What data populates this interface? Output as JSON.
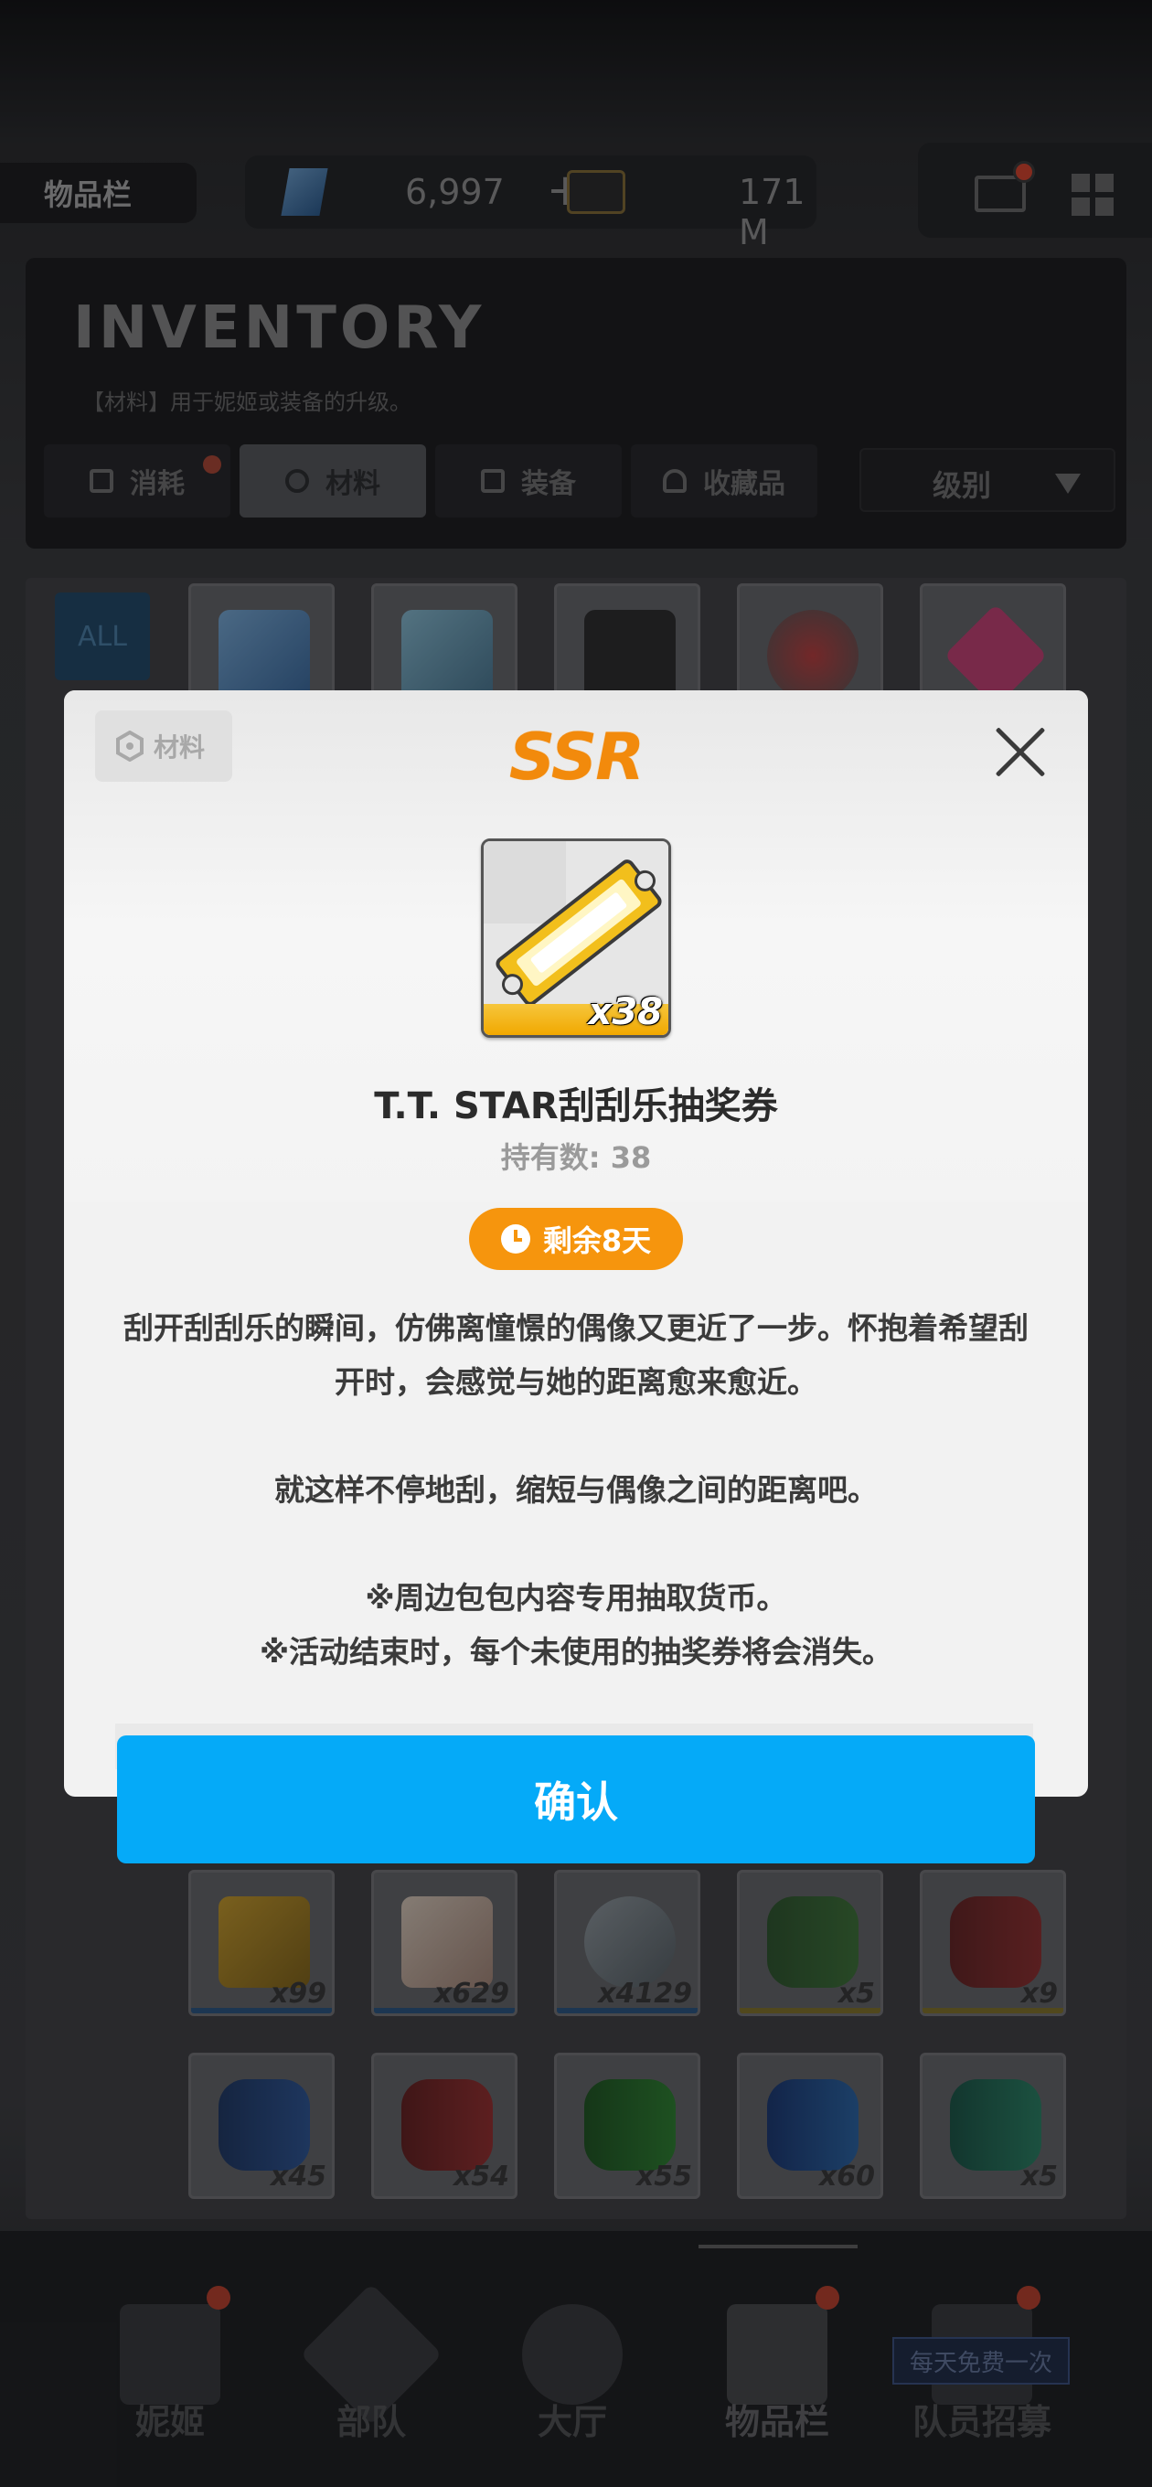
{
  "topbar": {
    "title": "物品栏",
    "gem_amount": "6,997",
    "plus": "+",
    "credit_amount": "171 M"
  },
  "inventory": {
    "title": "INVENTORY",
    "description": "【材料】用于妮姬或装备的升级。",
    "tabs": [
      {
        "label": "消耗",
        "active": false
      },
      {
        "label": "材料",
        "active": true
      },
      {
        "label": "装备",
        "active": false
      },
      {
        "label": "收藏品",
        "active": false
      }
    ],
    "sort_label": "级别",
    "filter_all": "ALL"
  },
  "grid_counts": {
    "row2": [
      "x99",
      "x629",
      "x4129",
      "x5",
      "x9"
    ],
    "row3": [
      "x45",
      "x54",
      "x55",
      "x60",
      "x5"
    ]
  },
  "nav": {
    "items": [
      "妮姬",
      "部队",
      "大厅",
      "物品栏",
      "队员招募"
    ],
    "active": "物品栏",
    "free_tag": "每天免费一次"
  },
  "modal": {
    "category_tag": "材料",
    "rarity": "SSR",
    "item_quantity": "x38",
    "item_name": "T.T. STAR刮刮乐抽奖券",
    "owned": "持有数: 38",
    "timer": "剩余8天",
    "description_lines": [
      "刮开刮刮乐的瞬间，仿佛离憧憬的偶像又更近了一步。怀抱着希望刮",
      "开时，会感觉与她的距离愈来愈近。",
      "",
      "就这样不停地刮，缩短与偶像之间的距离吧。",
      "",
      "※周边包包内容专用抽取货币。",
      "※活动结束时，每个未使用的抽奖券将会消失。"
    ],
    "confirm_label": "确认"
  },
  "colors": {
    "accent_blue": "#05aaf8",
    "rarity_orange": "#f28a0c",
    "timer_orange": "#f6950d",
    "notify_red": "#e8452c"
  }
}
